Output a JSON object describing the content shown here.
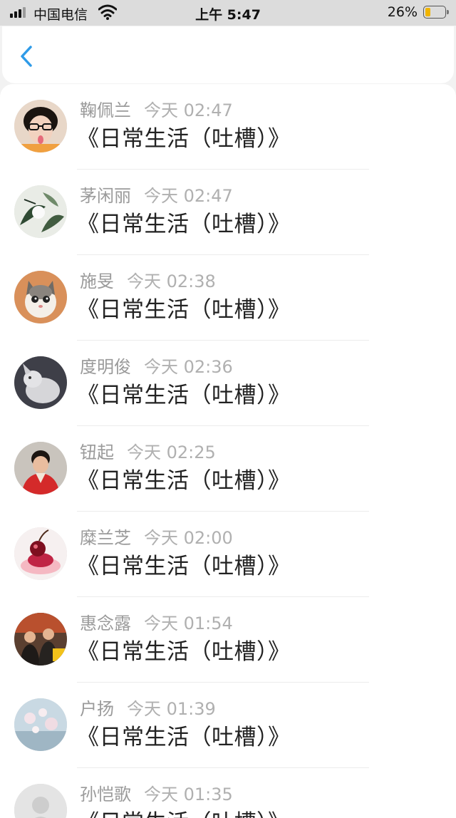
{
  "status_bar": {
    "carrier": "中国电信",
    "time": "上午 5:47",
    "battery_percent_label": "26%",
    "battery_level": 0.26,
    "battery_color": "#f0b400"
  },
  "nav": {
    "back_icon": "chevron-left-icon",
    "accent_color": "#2f9be8"
  },
  "items": [
    {
      "name": "鞠佩兰",
      "time": "今天 02:47",
      "title": "《日常生活（吐槽）》"
    },
    {
      "name": "茅闲丽",
      "time": "今天 02:47",
      "title": "《日常生活（吐槽）》"
    },
    {
      "name": "施旻",
      "time": "今天 02:38",
      "title": "《日常生活（吐槽）》"
    },
    {
      "name": "度明俊",
      "time": "今天 02:36",
      "title": "《日常生活（吐槽）》"
    },
    {
      "name": "钮起",
      "time": "今天 02:25",
      "title": "《日常生活（吐槽）》"
    },
    {
      "name": "糜兰芝",
      "time": "今天 02:00",
      "title": "《日常生活（吐槽）》"
    },
    {
      "name": "惠念露",
      "time": "今天 01:54",
      "title": "《日常生活（吐槽）》"
    },
    {
      "name": "户扬",
      "time": "今天 01:39",
      "title": "《日常生活（吐槽）》"
    },
    {
      "name": "孙恺歌",
      "time": "今天 01:35",
      "title": "《日常生活（吐槽）》"
    }
  ]
}
